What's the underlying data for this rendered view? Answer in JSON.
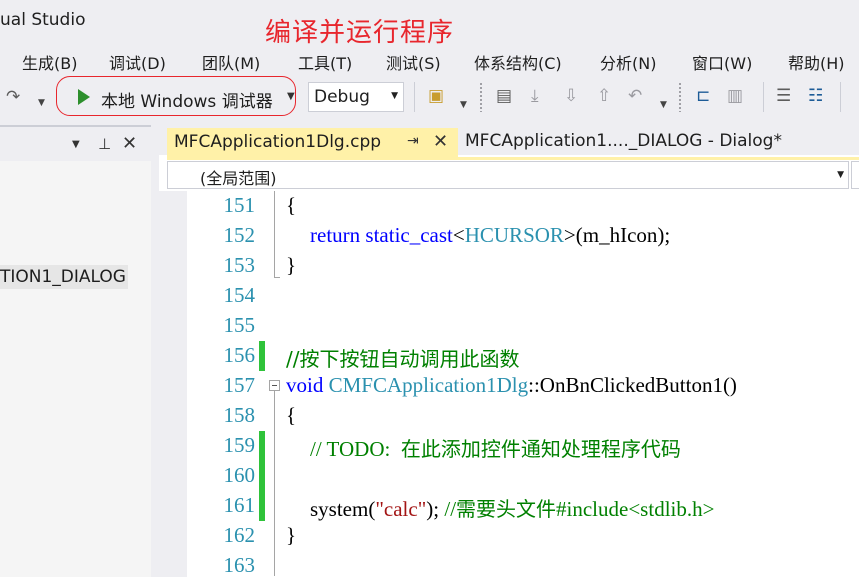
{
  "window": {
    "app_title": "ual Studio",
    "annotation": "编译并运行程序"
  },
  "menu": [
    {
      "label": "生成(B)"
    },
    {
      "label": "调试(D)"
    },
    {
      "label": "团队(M)"
    },
    {
      "label": "工具(T)"
    },
    {
      "label": "测试(S)"
    },
    {
      "label": "体系结构(C)"
    },
    {
      "label": "分析(N)"
    },
    {
      "label": "窗口(W)"
    },
    {
      "label": "帮助(H)"
    }
  ],
  "toolbar": {
    "run_label": "本地 Windows 调试器",
    "configuration": "Debug"
  },
  "solution_explorer": {
    "visible_item": "TION1_DIALOG"
  },
  "editor": {
    "tabs": [
      {
        "label": "MFCApplication1Dlg.cpp",
        "active": true
      },
      {
        "label": "MFCApplication1...._DIALOG - Dialog*",
        "active": false
      }
    ],
    "scope": "(全局范围)",
    "lines": [
      {
        "num": "151",
        "text": "{"
      },
      {
        "num": "152",
        "kw": "return",
        "kw2": "static_cast",
        "lt": "<",
        "type": "HCURSOR",
        "rest": ">(m_hIcon);"
      },
      {
        "num": "153",
        "text": "}"
      },
      {
        "num": "154",
        "text": ""
      },
      {
        "num": "155",
        "text": ""
      },
      {
        "num": "156",
        "comment": "//按下按钮自动调用此函数"
      },
      {
        "num": "157",
        "kw": "void",
        "type": "CMFCApplication1Dlg",
        "rest": "::OnBnClickedButton1()"
      },
      {
        "num": "158",
        "text": "{"
      },
      {
        "num": "159",
        "comment_a": "// TODO:  ",
        "comment_b": "在此添加控件通知处理程序代码"
      },
      {
        "num": "160",
        "text": ""
      },
      {
        "num": "161",
        "fn": "system(",
        "str": "\"calc\"",
        "mid": "); ",
        "comment_a": "//",
        "comment_b": "需要头文件",
        "comment_c": "#include<stdlib.h>"
      },
      {
        "num": "162",
        "text": "}"
      },
      {
        "num": "163",
        "text": ""
      }
    ]
  },
  "colors": {
    "keyword": "#0000ff",
    "type": "#2b91af",
    "string": "#a31515",
    "comment": "#008000",
    "line_number": "#2b91af",
    "active_tab": "#fff1a8",
    "change_bar": "#2fc33a",
    "annotation": "#e8262d"
  }
}
